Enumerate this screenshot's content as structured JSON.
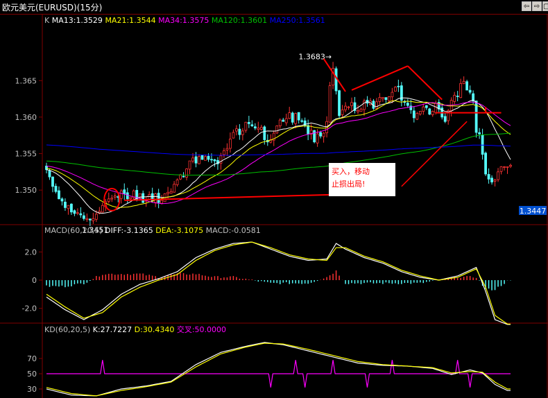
{
  "window": {
    "title": "欧元美元(EURUSD)(15分)",
    "buttons": [
      "⇦",
      "⇨",
      "▢"
    ]
  },
  "colors": {
    "background": "#000000",
    "frame": "#800000",
    "axis_text": "#c0c0c0",
    "candle_up": "#ff3232",
    "candle_down": "#54fcfc",
    "ma13": "#ffffff",
    "ma21": "#ffff00",
    "ma34": "#ff00ff",
    "ma120": "#00c000",
    "ma250": "#0000ff",
    "diff": "#ffffff",
    "dea": "#ffff00",
    "kline_k": "#ffffff",
    "kline_d": "#ffff00",
    "cross": "#ff00ff",
    "annotation": "#ff0000"
  },
  "chart_data": [
    {
      "type": "candlestick",
      "pane": "price",
      "ylim": [
        1.3465,
        1.3712
      ],
      "yticks": [
        1.35,
        1.355,
        1.36,
        1.365
      ],
      "ytick_labels": [
        "1.350",
        "1.355",
        "1.360",
        "1.365"
      ],
      "legend": [
        {
          "text": "K",
          "color": "#c0c0c0"
        },
        {
          "text": "MA13:1.3529",
          "color": "#ffffff"
        },
        {
          "text": "MA21:1.3544",
          "color": "#ffff00"
        },
        {
          "text": "MA34:1.3575",
          "color": "#ff00ff"
        },
        {
          "text": "MA120:1.3601",
          "color": "#00c000"
        },
        {
          "text": "MA250:1.3561",
          "color": "#0000ff"
        }
      ],
      "closes": [
        1.3528,
        1.3518,
        1.3505,
        1.3498,
        1.3488,
        1.3485,
        1.3476,
        1.3479,
        1.347,
        1.3468,
        1.3469,
        1.3466,
        1.3461,
        1.3461,
        1.3459,
        1.3461,
        1.3467,
        1.3471,
        1.3479,
        1.3484,
        1.3488,
        1.3489,
        1.3492,
        1.349,
        1.3499,
        1.3495,
        1.3488,
        1.349,
        1.3499,
        1.3487,
        1.3495,
        1.3483,
        1.3487,
        1.3494,
        1.3485,
        1.3495,
        1.3483,
        1.3486,
        1.3495,
        1.3497,
        1.3498,
        1.3508,
        1.3514,
        1.3521,
        1.3518,
        1.3529,
        1.354,
        1.3544,
        1.3537,
        1.3546,
        1.3542,
        1.3546,
        1.3542,
        1.3542,
        1.354,
        1.3536,
        1.3547,
        1.3554,
        1.3557,
        1.357,
        1.3579,
        1.3584,
        1.3576,
        1.3581,
        1.3593,
        1.3591,
        1.3588,
        1.3585,
        1.3585,
        1.3586,
        1.3569,
        1.3566,
        1.3569,
        1.3578,
        1.3588,
        1.3596,
        1.3594,
        1.3598,
        1.3606,
        1.3593,
        1.3605,
        1.3596,
        1.3594,
        1.3588,
        1.3577,
        1.3582,
        1.3566,
        1.3577,
        1.3574,
        1.3578,
        1.3594,
        1.3643,
        1.3667,
        1.3636,
        1.3602,
        1.361,
        1.3615,
        1.3614,
        1.362,
        1.3609,
        1.3609,
        1.3611,
        1.3622,
        1.3619,
        1.3622,
        1.3612,
        1.3621,
        1.3627,
        1.3627,
        1.3624,
        1.3628,
        1.3634,
        1.3641,
        1.3642,
        1.3623,
        1.3621,
        1.3616,
        1.361,
        1.3599,
        1.3605,
        1.3608,
        1.3614,
        1.3613,
        1.3604,
        1.3608,
        1.3619,
        1.3611,
        1.36,
        1.3594,
        1.3609,
        1.3623,
        1.363,
        1.3628,
        1.3646,
        1.3649,
        1.3637,
        1.3634,
        1.3622,
        1.3579,
        1.3577,
        1.3549,
        1.3522,
        1.3515,
        1.3511,
        1.3514,
        1.3525,
        1.3532,
        1.3532,
        1.3532,
        1.3534
      ],
      "high_label": {
        "value": "1.3683",
        "text": "1.3683→"
      },
      "low_label": {
        "value": "1.3451",
        "text": "1.3451"
      },
      "current_label": "1.3447",
      "annotation": "买入，移动止损出局!"
    },
    {
      "type": "line",
      "pane": "macd",
      "ylim": [
        -2.9,
        3.0
      ],
      "yticks": [
        2.0,
        0,
        -2.0
      ],
      "ytick_labels": [
        "2.0",
        "0",
        "-2.0"
      ],
      "legend": [
        {
          "text": "MACD(60,20,5)",
          "color": "#c0c0c0"
        },
        {
          "text": "DIFF:-3.1365",
          "color": "#ffffff"
        },
        {
          "text": "DEA:-3.1075",
          "color": "#ffff00"
        },
        {
          "text": "MACD:-0.0581",
          "color": "#c0c0c0"
        }
      ],
      "series": [
        {
          "name": "DIFF",
          "color": "#ffffff",
          "x": [
            0,
            6,
            12,
            18,
            24,
            30,
            36,
            42,
            48,
            54,
            60,
            66,
            72,
            78,
            84,
            90,
            93,
            96,
            102,
            108,
            114,
            120,
            126,
            132,
            138,
            141,
            144,
            148
          ],
          "values": [
            -1.2,
            -2.1,
            -2.8,
            -2.1,
            -1.0,
            -0.3,
            0.1,
            0.6,
            1.6,
            2.2,
            2.6,
            2.7,
            2.2,
            1.7,
            1.4,
            1.5,
            2.6,
            2.2,
            1.6,
            1.2,
            0.6,
            0.2,
            0.0,
            0.3,
            0.9,
            -0.8,
            -2.8,
            -3.14
          ]
        },
        {
          "name": "DEA",
          "color": "#ffff00",
          "x": [
            0,
            6,
            12,
            18,
            24,
            30,
            36,
            42,
            48,
            54,
            60,
            66,
            72,
            78,
            84,
            90,
            93,
            96,
            102,
            108,
            114,
            120,
            126,
            132,
            138,
            141,
            144,
            148
          ],
          "values": [
            -1.0,
            -1.9,
            -2.7,
            -2.3,
            -1.2,
            -0.5,
            0.0,
            0.4,
            1.4,
            2.1,
            2.5,
            2.7,
            2.3,
            1.8,
            1.5,
            1.4,
            2.3,
            2.3,
            1.7,
            1.3,
            0.7,
            0.3,
            0.0,
            0.2,
            0.8,
            -0.5,
            -2.5,
            -3.11
          ]
        }
      ]
    },
    {
      "type": "line",
      "pane": "kd",
      "ylim": [
        20,
        100
      ],
      "yticks": [
        70,
        50,
        30
      ],
      "ytick_labels": [
        "70",
        "50",
        "30"
      ],
      "legend": [
        {
          "text": "KD(60,20,5)",
          "color": "#c0c0c0"
        },
        {
          "text": "K:27.7227",
          "color": "#ffffff"
        },
        {
          "text": "D:30.4340",
          "color": "#ffff00"
        },
        {
          "text": "交叉:50.0000",
          "color": "#ff00ff"
        }
      ],
      "series": [
        {
          "name": "K",
          "color": "#ffffff",
          "x": [
            0,
            8,
            16,
            24,
            32,
            40,
            48,
            56,
            64,
            70,
            76,
            84,
            92,
            100,
            108,
            116,
            124,
            130,
            136,
            140,
            144,
            148
          ],
          "values": [
            30,
            22,
            21,
            30,
            34,
            40,
            62,
            78,
            86,
            91,
            88,
            80,
            72,
            64,
            61,
            60,
            57,
            49,
            55,
            51,
            36,
            28
          ]
        },
        {
          "name": "D",
          "color": "#ffff00",
          "x": [
            0,
            8,
            16,
            24,
            32,
            40,
            48,
            56,
            64,
            70,
            76,
            84,
            92,
            100,
            108,
            116,
            124,
            130,
            136,
            140,
            144,
            148
          ],
          "values": [
            32,
            24,
            21,
            28,
            33,
            39,
            59,
            76,
            85,
            90,
            89,
            82,
            74,
            66,
            62,
            60,
            58,
            51,
            53,
            52,
            39,
            30
          ]
        },
        {
          "name": "交叉",
          "color": "#ff00ff",
          "x": [
            0,
            148
          ],
          "values": [
            50,
            50
          ],
          "spikes_up": [
            18,
            80,
            92,
            111,
            132
          ],
          "spikes_down": [
            72,
            83,
            103,
            136
          ]
        }
      ]
    }
  ]
}
